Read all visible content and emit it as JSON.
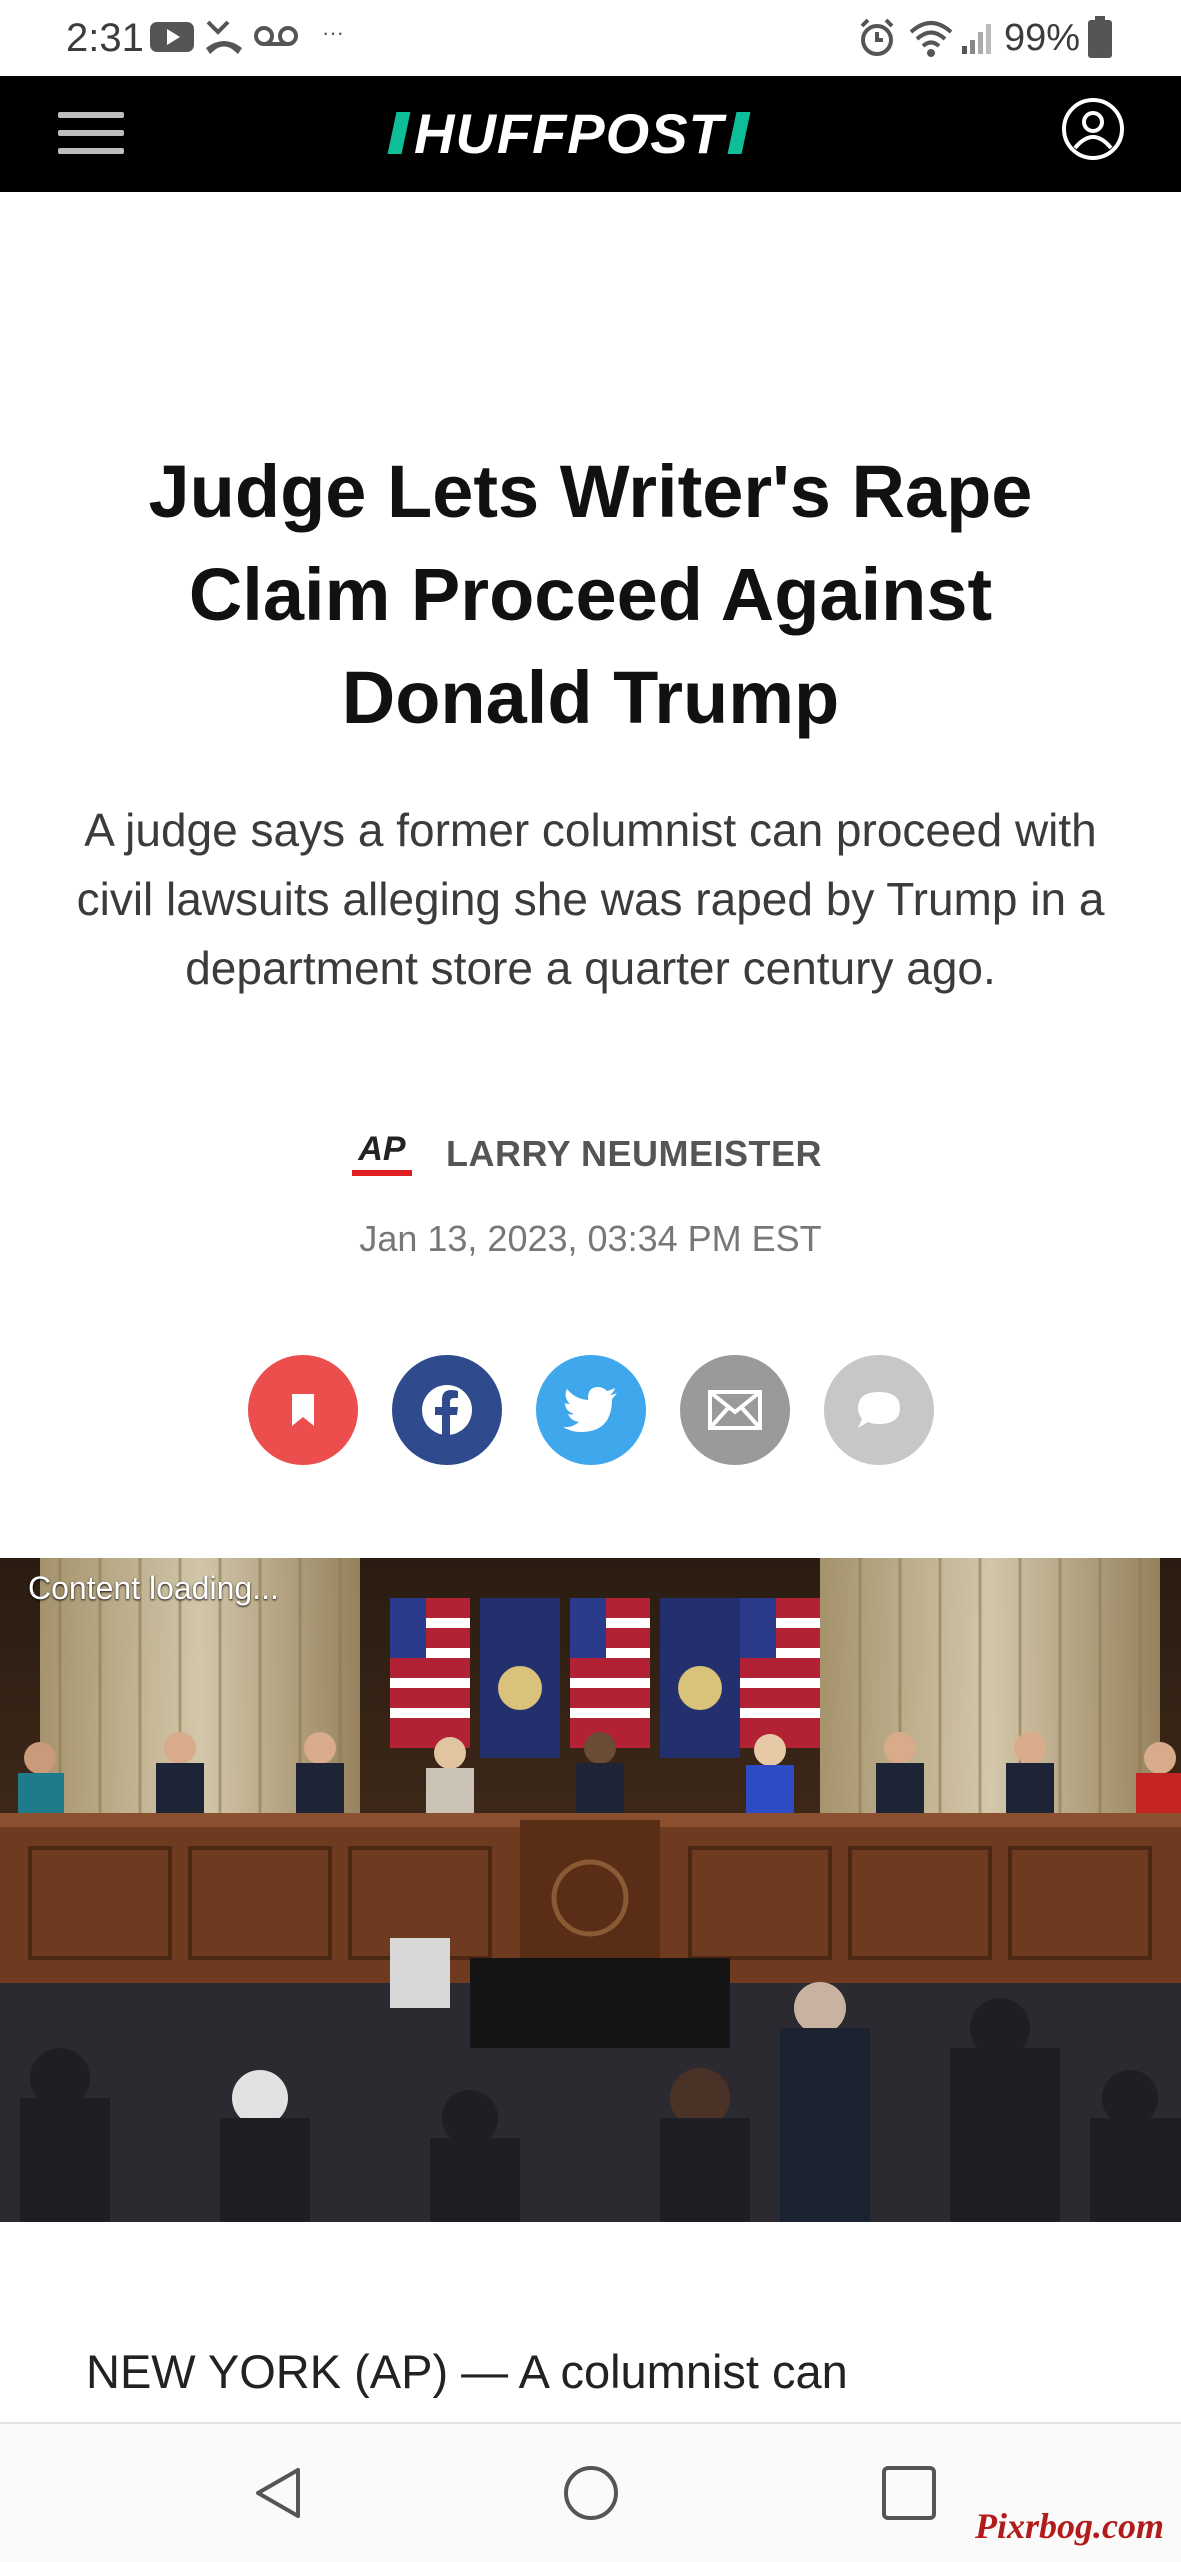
{
  "status_bar": {
    "time": "2:31",
    "battery_percent": "99%",
    "more_indicator": "···",
    "icons": [
      "youtube-icon",
      "missed-call-icon",
      "voicemail-icon",
      "alarm-icon",
      "wifi-icon",
      "signal-icon",
      "battery-icon"
    ]
  },
  "header": {
    "brand": "HUFFPOST",
    "brand_color": "#0dbe98",
    "menu_icon": "hamburger-menu-icon",
    "account_icon": "user-account-icon"
  },
  "article": {
    "headline": "Judge Lets Writer's Rape Claim Proceed Against Donald Trump",
    "dek": "A judge says a former columnist can proceed with civil lawsuits alleging she was raped by Trump in a department store a quarter century ago.",
    "source_logo": "AP",
    "author": "LARRY NEUMEISTER",
    "date": "Jan 13, 2023, 03:34 PM EST",
    "image_label": "Content loading...",
    "body_start": "NEW YORK (AP) — A columnist can"
  },
  "share": [
    {
      "name": "bookmark",
      "icon": "bookmark-icon",
      "color": "#ec4d4d"
    },
    {
      "name": "facebook",
      "icon": "facebook-icon",
      "color": "#2f4a8d"
    },
    {
      "name": "twitter",
      "icon": "twitter-icon",
      "color": "#3fa7ec"
    },
    {
      "name": "email",
      "icon": "email-icon",
      "color": "#9a9a9a"
    },
    {
      "name": "comments",
      "icon": "comment-icon",
      "color": "#c7c7c7"
    }
  ],
  "nav_bar": {
    "buttons": [
      "back-icon",
      "home-icon",
      "recents-icon"
    ]
  },
  "watermark": "Pixrbog.com"
}
